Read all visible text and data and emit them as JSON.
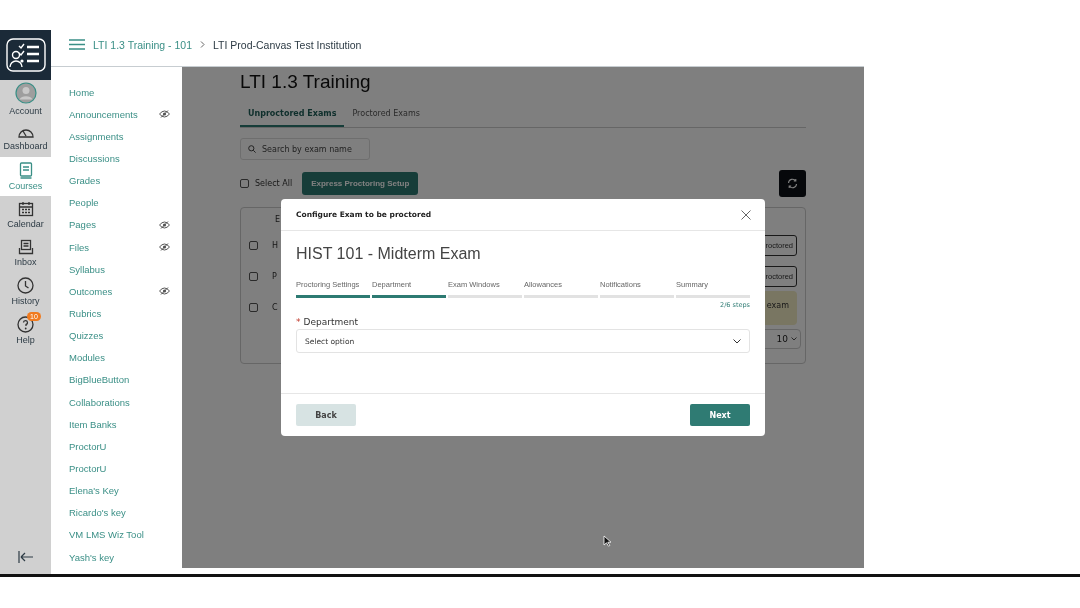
{
  "global_nav": [
    {
      "label": "Account",
      "selected": false
    },
    {
      "label": "Dashboard",
      "selected": false
    },
    {
      "label": "Courses",
      "selected": true
    },
    {
      "label": "Calendar",
      "selected": false
    },
    {
      "label": "Inbox",
      "selected": false
    },
    {
      "label": "History",
      "selected": false
    },
    {
      "label": "Help",
      "selected": false,
      "badge": "10"
    }
  ],
  "breadcrumbs": [
    "LTI 1.3 Training - 101",
    "LTI Prod-Canvas Test Institution"
  ],
  "course_nav": [
    {
      "label": "Home",
      "hidden": false
    },
    {
      "label": "Announcements",
      "hidden": true
    },
    {
      "label": "Assignments",
      "hidden": false
    },
    {
      "label": "Discussions",
      "hidden": false
    },
    {
      "label": "Grades",
      "hidden": false
    },
    {
      "label": "People",
      "hidden": false
    },
    {
      "label": "Pages",
      "hidden": true
    },
    {
      "label": "Files",
      "hidden": true
    },
    {
      "label": "Syllabus",
      "hidden": false
    },
    {
      "label": "Outcomes",
      "hidden": true
    },
    {
      "label": "Rubrics",
      "hidden": false
    },
    {
      "label": "Quizzes",
      "hidden": false
    },
    {
      "label": "Modules",
      "hidden": false
    },
    {
      "label": "BigBlueButton",
      "hidden": false
    },
    {
      "label": "Collaborations",
      "hidden": false
    },
    {
      "label": "Item Banks",
      "hidden": false
    },
    {
      "label": "ProctorU",
      "hidden": false
    },
    {
      "label": "ProctorU",
      "hidden": false
    },
    {
      "label": "Elena's Key",
      "hidden": false
    },
    {
      "label": "Ricardo's key",
      "hidden": false
    },
    {
      "label": "VM LMS Wiz Tool",
      "hidden": false
    },
    {
      "label": "Yash's key",
      "hidden": false
    }
  ],
  "page": {
    "title": "LTI 1.3 Training",
    "tabs": [
      {
        "label": "Unproctored Exams",
        "selected": true
      },
      {
        "label": "Proctored Exams",
        "selected": false
      }
    ],
    "search": {
      "placeholder": "Search by exam name"
    },
    "select_all": {
      "label": "Select All",
      "checked": false
    },
    "express_button": "Express Proctoring Setup",
    "table": {
      "header": "E",
      "rows": [
        {
          "name": "H",
          "checked": false,
          "action": "roctored",
          "kind": "outline"
        },
        {
          "name": "P",
          "checked": false,
          "action": "roctored",
          "kind": "outline"
        },
        {
          "name": "C",
          "checked": false,
          "action": "exam",
          "kind": "tag"
        }
      ],
      "page_size": "10"
    }
  },
  "modal": {
    "title": "Configure Exam to be proctored",
    "exam_title": "HIST 101 - Midterm Exam",
    "steps": [
      {
        "label": "Proctoring Settings",
        "done": true
      },
      {
        "label": "Department",
        "done": true
      },
      {
        "label": "Exam Windows",
        "done": false
      },
      {
        "label": "Allowances",
        "done": false
      },
      {
        "label": "Notifications",
        "done": false
      },
      {
        "label": "Summary",
        "done": false
      }
    ],
    "step_count": "2/6 steps",
    "field": {
      "required_mark": "*",
      "label": "Department",
      "placeholder": "Select option"
    },
    "back": "Back",
    "next": "Next"
  }
}
